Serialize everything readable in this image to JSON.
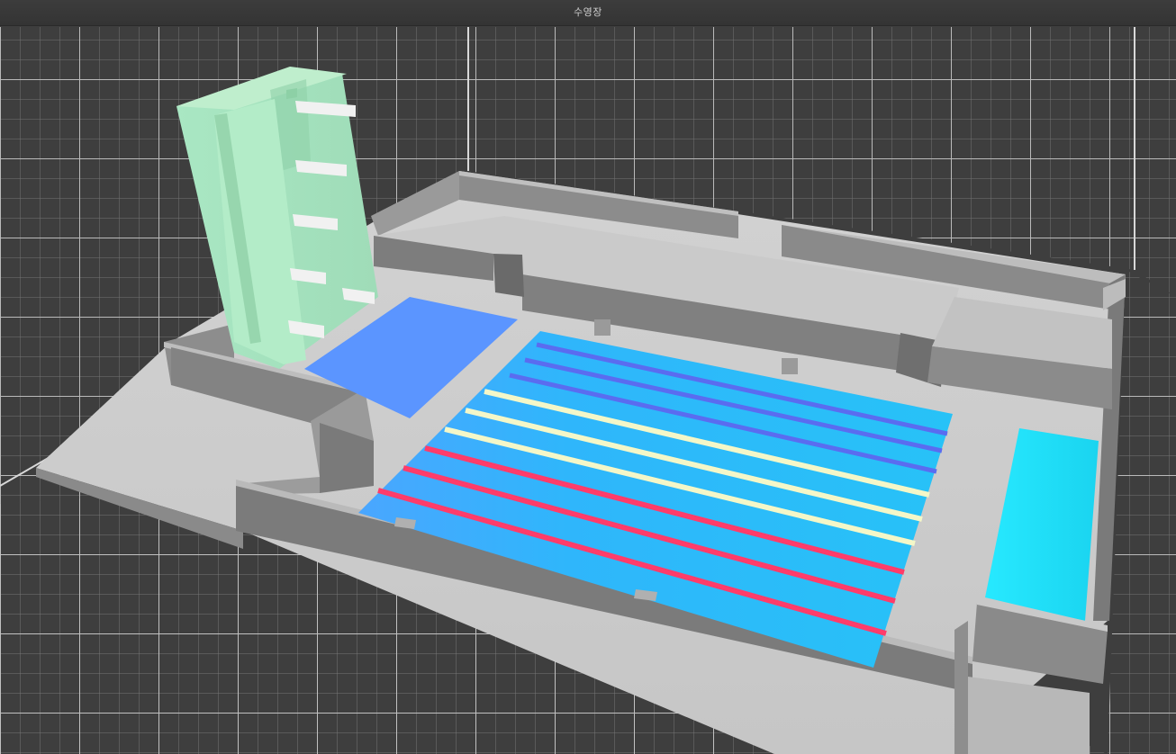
{
  "window": {
    "title": "수영장"
  },
  "scene": {
    "background_color": "#3c3c3c",
    "grid_color": "#8a8a8a",
    "grid_major_color": "#cfcfcf",
    "floor_color": "#cfcfcf",
    "wall_color": "#7a7a7a",
    "wall_top_color": "#d6d6d6",
    "tower_color": "#a8e6c0",
    "main_pool_color": "#27bff5",
    "diving_pool_color": "#5e96ff",
    "side_pool_color": "#1fe7ff",
    "lane_colors": {
      "blue": "#5a6cf0",
      "yellow": "#f4f7c8",
      "red": "#ff3c6a"
    }
  }
}
